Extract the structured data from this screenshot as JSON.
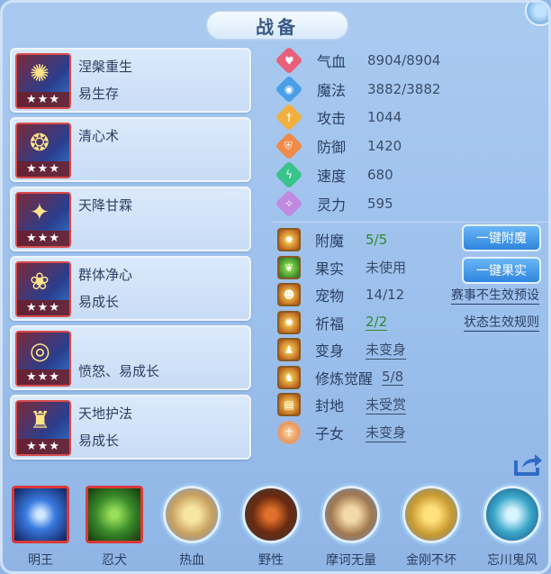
{
  "window": {
    "title": "战备"
  },
  "left_cards": [
    {
      "line1": "涅槃重生",
      "line2": "易生存",
      "stars": "★★★"
    },
    {
      "line1": "清心术",
      "line2": "",
      "stars": "★★★"
    },
    {
      "line1": "天降甘霖",
      "line2": "",
      "stars": "★★★"
    },
    {
      "line1": "群体净心",
      "line2": "易成长",
      "stars": "★★★"
    },
    {
      "line1": "",
      "line2": "愤怒、易成长",
      "stars": "★★★"
    },
    {
      "line1": "天地护法",
      "line2": "易成长",
      "stars": "★★★"
    }
  ],
  "stats": [
    {
      "label": "气血",
      "value": "8904/8904",
      "icon": "heart-icon",
      "color": "#e8607a"
    },
    {
      "label": "魔法",
      "value": "3882/3882",
      "icon": "mana-icon",
      "color": "#4a9ee8"
    },
    {
      "label": "攻击",
      "value": "1044",
      "icon": "sword-icon",
      "color": "#f0b040"
    },
    {
      "label": "防御",
      "value": "1420",
      "icon": "armor-icon",
      "color": "#f08a4a"
    },
    {
      "label": "速度",
      "value": "680",
      "icon": "lightning-icon",
      "color": "#38c48a"
    },
    {
      "label": "灵力",
      "value": "595",
      "icon": "spirit-icon",
      "color": "#c08ae0"
    }
  ],
  "info": [
    {
      "label": "附魔",
      "value": "5/5"
    },
    {
      "label": "果实",
      "value": "未使用"
    },
    {
      "label": "宠物",
      "value": "14/12"
    },
    {
      "label": "祈福",
      "value": "2/2"
    },
    {
      "label": "变身",
      "value": "未变身"
    },
    {
      "label": "修炼觉醒",
      "value": "5/8"
    },
    {
      "label": "封地",
      "value": "未受赏"
    },
    {
      "label": "子女",
      "value": "未变身"
    }
  ],
  "buttons": {
    "enchant": "一键附魔",
    "fruit": "一键果实"
  },
  "links": {
    "preset": "赛事不生效预设",
    "rules": "状态生效规则"
  },
  "skills": [
    {
      "name": "明王"
    },
    {
      "name": "忍犬"
    },
    {
      "name": "热血"
    },
    {
      "name": "野性"
    },
    {
      "name": "摩诃无量"
    },
    {
      "name": "金刚不坏"
    },
    {
      "name": "忘川鬼风"
    }
  ]
}
